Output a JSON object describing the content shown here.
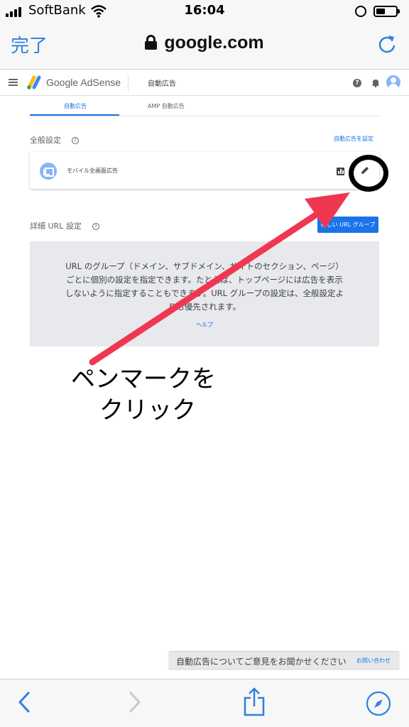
{
  "status_bar": {
    "carrier": "SoftBank",
    "time": "16:04"
  },
  "safari_top": {
    "done_label": "完了",
    "url": "google.com"
  },
  "adsense_header": {
    "brand": "Google AdSense",
    "title": "自動広告",
    "help_glyph": "?"
  },
  "tabs": [
    {
      "label": "自動広告",
      "active": true
    },
    {
      "label": "AMP 自動広告",
      "active": false
    }
  ],
  "general_settings": {
    "title": "全般設定",
    "link": "自動広告を設定",
    "card": {
      "label": "モバイル全画面広告",
      "icon": "format-icon"
    }
  },
  "url_settings": {
    "title": "詳細 URL 設定",
    "button": "新しい URL グループ",
    "info_text": "URL のグループ（ドメイン、サブドメイン、サイトのセクション、ページ）ごとに個別の設定を指定できます。たとえば、トップページには広告を表示しないように指定することもできます。URL グループの設定は、全般設定よりも優先されます。",
    "help_link": "ヘルプ"
  },
  "annotation": {
    "line1": "ペンマークを",
    "line2": "クリック",
    "arrow_color": "#f03752"
  },
  "feedback": {
    "text": "自動広告についてご意見をお聞かせください",
    "link": "お問い合わせ"
  },
  "colors": {
    "accent": "#1a73e8",
    "ios_blue": "#2f7fe0",
    "info_box": "#e8e9ec"
  }
}
